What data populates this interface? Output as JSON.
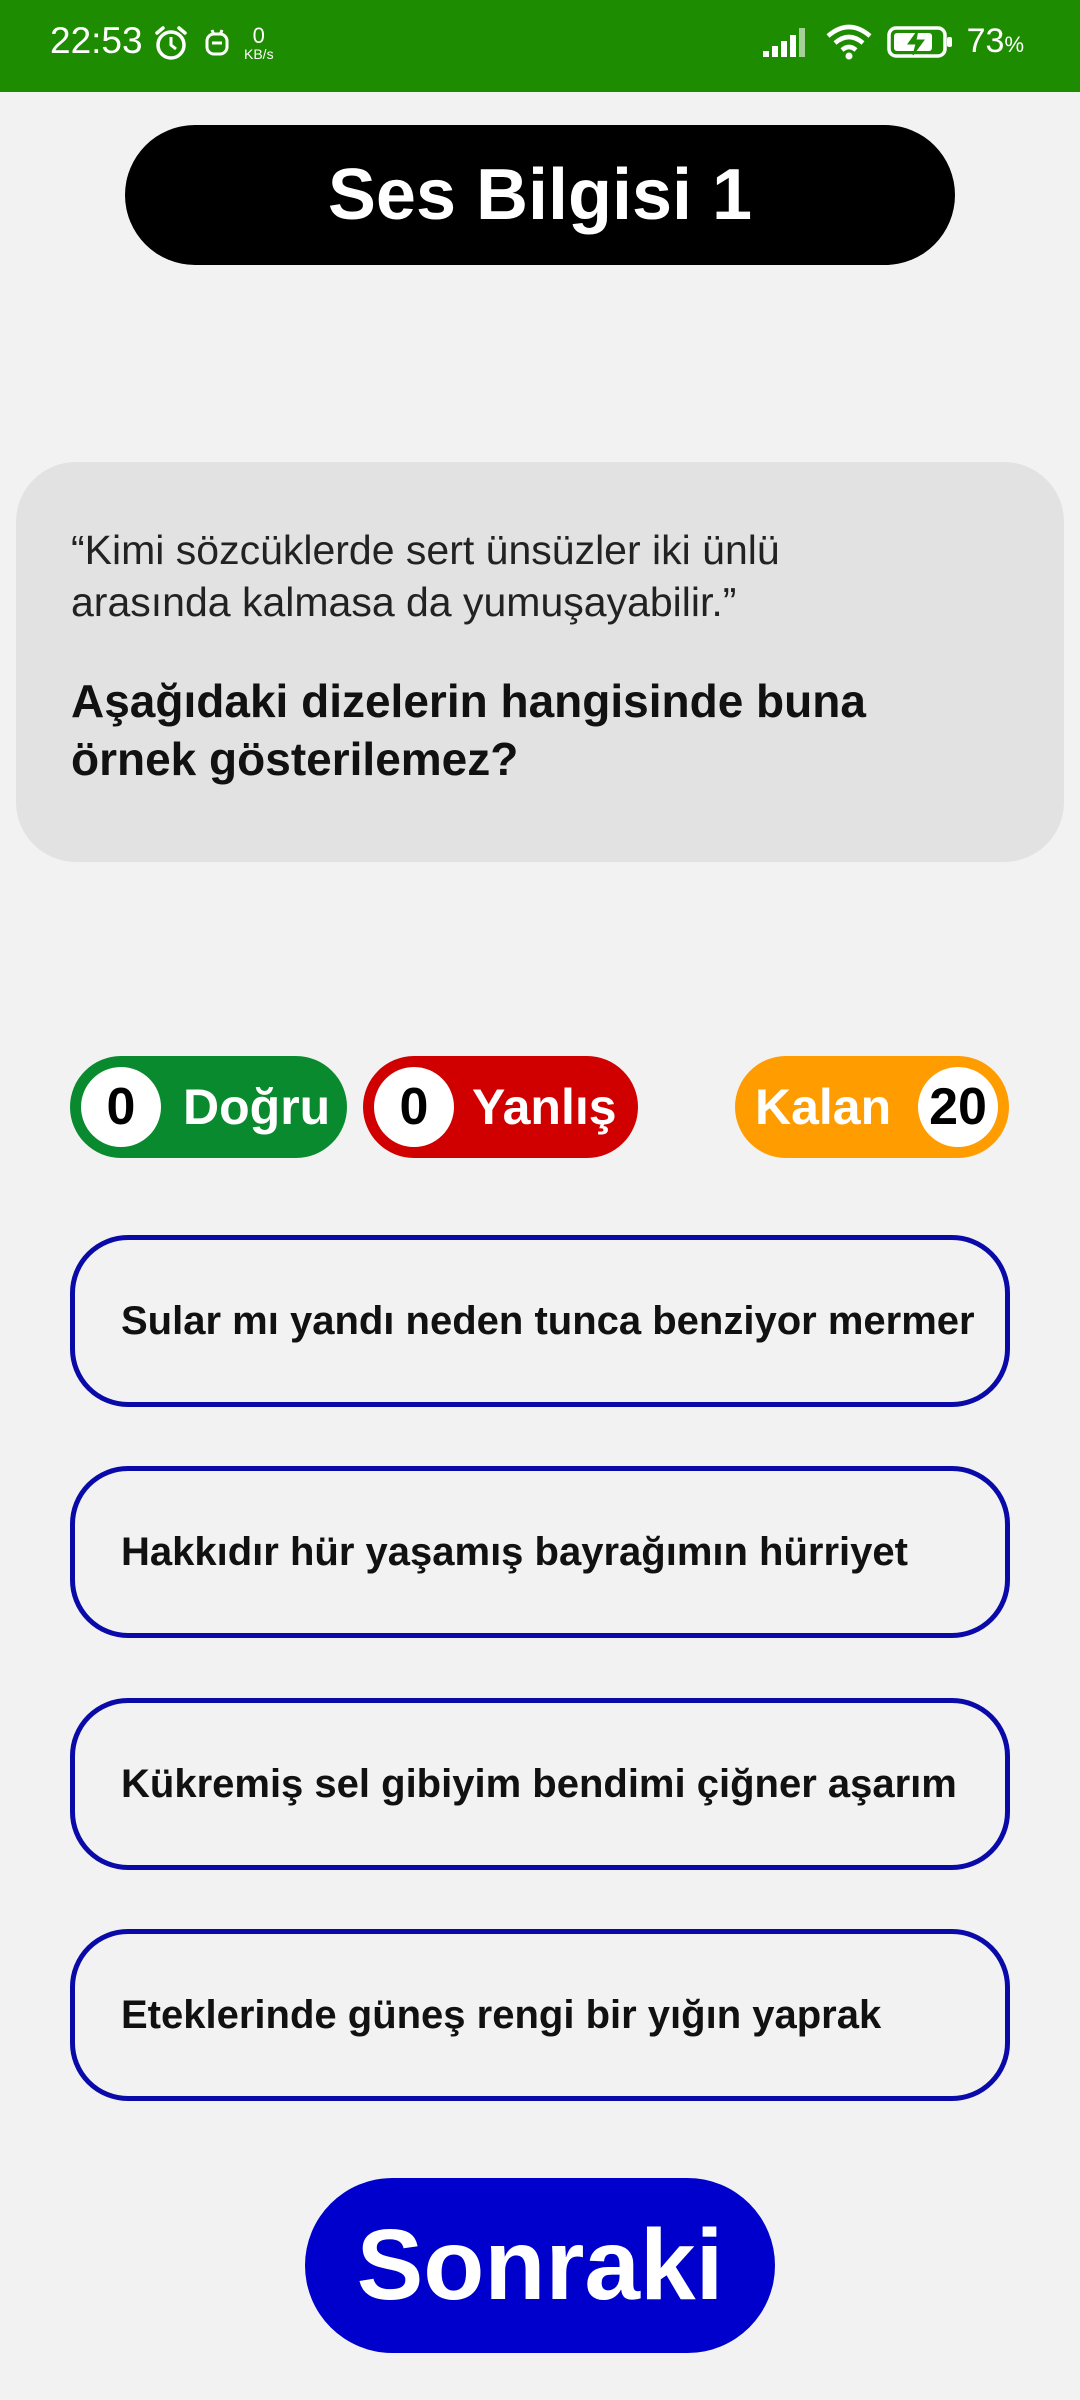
{
  "status_bar": {
    "time": "22:53",
    "net_speed_value": "0",
    "net_speed_unit": "KB/s",
    "battery_percent": "73",
    "battery_unit": "%",
    "icons": [
      "alarm-icon",
      "notification-icon",
      "signal-icon",
      "wifi-icon",
      "battery-charging-icon"
    ],
    "background_color": "#1e8c00"
  },
  "header": {
    "title": "Ses Bilgisi 1"
  },
  "question": {
    "quote_line1": "“Kimi sözcüklerde sert ünsüzler iki ünlü",
    "quote_line2": "arasında kalmasa da yumuşayabilir.”",
    "ask_line1": "Aşağıdaki dizelerin hangisinde buna",
    "ask_line2": "örnek gösterilemez?"
  },
  "scores": {
    "correct": {
      "count": "0",
      "label": "Doğru",
      "color": "#0a8a2e"
    },
    "wrong": {
      "count": "0",
      "label": "Yanlış",
      "color": "#d00000"
    },
    "remaining": {
      "label": "Kalan",
      "count": "20",
      "color": "#ff9c00"
    }
  },
  "options": [
    {
      "text": "Sular mı yandı neden tunca benziyor mermer"
    },
    {
      "text": "Hakkıdır hür yaşamış bayrağımın hürriyet"
    },
    {
      "text": "Kükremiş sel gibiyim bendimi çiğner aşarım"
    },
    {
      "text": "Eteklerinde güneş rengi bir yığın yaprak"
    }
  ],
  "next_button": {
    "label": "Sonraki",
    "color": "#0000cc"
  },
  "accent_color": "#0a0aa8"
}
